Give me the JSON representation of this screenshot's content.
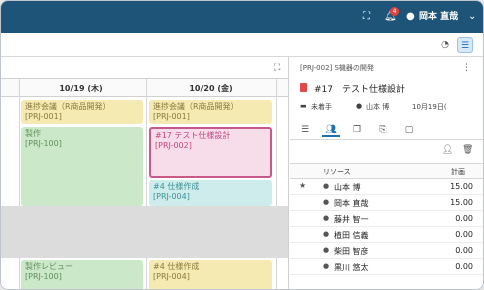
{
  "header": {
    "notifications": "4",
    "user": "岡本 直哉"
  },
  "calendar": {
    "days": [
      "10/19 (木)",
      "10/20 (金)"
    ],
    "events": [
      {
        "title": "進捗会議（R商品開発）",
        "code": "[PRJ-001]"
      },
      {
        "title": "製作",
        "code": "[PRJ-100]"
      },
      {
        "title": "製作レビュー",
        "code": "[PRJ-100]"
      },
      {
        "title": "進捗会議（R商品開発）",
        "code": "[PRJ-001]"
      },
      {
        "title": "#17 テスト仕様設計",
        "code": "[PRJ-002]"
      },
      {
        "title": "#4 仕様作成",
        "code": "[PRJ-004]"
      },
      {
        "title": "#4 仕様作成",
        "code": "[PRJ-004]"
      }
    ]
  },
  "panel": {
    "breadcrumb": "[PRJ-002] S機器の開発",
    "task_title": "#17　テスト仕様設計",
    "status": "未着手",
    "assignee": "山本 博",
    "date": "10月19日(",
    "columns": {
      "resource": "リソース",
      "plan": "計画"
    },
    "resources": [
      {
        "name": "山本 博",
        "value": "15.00",
        "starred": true
      },
      {
        "name": "岡本 直哉",
        "value": "15.00",
        "starred": false
      },
      {
        "name": "藤井 智一",
        "value": "0.00",
        "starred": false
      },
      {
        "name": "植田 信義",
        "value": "0.00",
        "starred": false
      },
      {
        "name": "柴田 智彦",
        "value": "0.00",
        "starred": false
      },
      {
        "name": "黒川 悠太",
        "value": "0.00",
        "starred": false
      }
    ]
  },
  "colors": {
    "header": "#1d5478",
    "accent": "#1d6fb8",
    "task_red": "#e24848"
  }
}
